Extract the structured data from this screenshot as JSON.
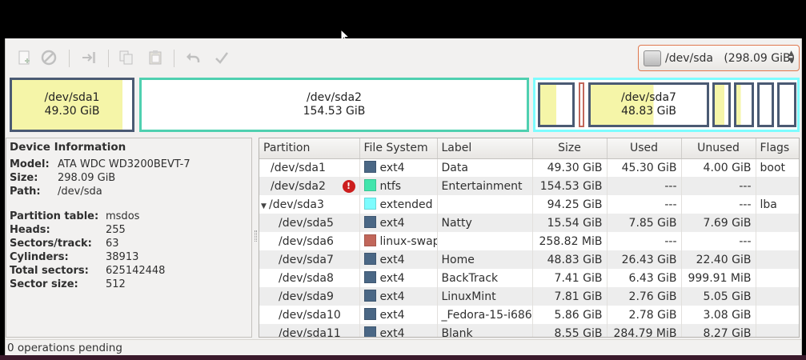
{
  "device_selector": {
    "label": "/dev/sda   (298.09 GiB)",
    "icon": "harddisk-icon"
  },
  "toolbar": {
    "icons": [
      "new-partition-icon",
      "delete-icon",
      "resize-move-icon",
      "copy-icon",
      "paste-icon",
      "undo-icon",
      "apply-icon"
    ]
  },
  "partition_bar": [
    {
      "name": "/dev/sda1",
      "size": "49.30 GiB",
      "border": "#4a5a73",
      "used_fill": 0.92
    },
    {
      "name": "/dev/sda2",
      "size": "154.53 GiB",
      "border": "#4fd0b0",
      "used_fill": 0.0
    },
    {
      "name": "/dev/sda7",
      "size": "48.83 GiB",
      "border": "#4a5a73",
      "used_fill": 0.54
    }
  ],
  "device_info": {
    "title": "Device Information",
    "model_label": "Model:",
    "model": "ATA WDC WD3200BEVT-7",
    "size_label": "Size:",
    "size": "298.09 GiB",
    "path_label": "Path:",
    "path": "/dev/sda",
    "table_label": "Partition table:",
    "table": "msdos",
    "heads_label": "Heads:",
    "heads": "255",
    "sectors_label": "Sectors/track:",
    "sectors": "63",
    "cylinders_label": "Cylinders:",
    "cylinders": "38913",
    "total_label": "Total sectors:",
    "total": "625142448",
    "sectorsize_label": "Sector size:",
    "sectorsize": "512"
  },
  "table": {
    "headers": [
      "Partition",
      "File System",
      "Label",
      "Size",
      "Used",
      "Unused",
      "Flags"
    ],
    "rows": [
      {
        "partition": "/dev/sda1",
        "fs": "ext4",
        "color": "#4a6785",
        "label": "Data",
        "size": "49.30 GiB",
        "used": "45.30 GiB",
        "unused": "4.00 GiB",
        "flags": "boot"
      },
      {
        "partition": "/dev/sda2",
        "fs": "ntfs",
        "color": "#42e5ac",
        "label": "Entertainment",
        "size": "154.53 GiB",
        "used": "---",
        "unused": "---",
        "flags": ""
      },
      {
        "partition": "/dev/sda3",
        "fs": "extended",
        "color": "#7dfcfe",
        "label": "",
        "size": "94.25 GiB",
        "used": "---",
        "unused": "---",
        "flags": "lba"
      },
      {
        "partition": "/dev/sda5",
        "fs": "ext4",
        "color": "#4a6785",
        "label": "Natty",
        "size": "15.54 GiB",
        "used": "7.85 GiB",
        "unused": "7.69 GiB",
        "flags": ""
      },
      {
        "partition": "/dev/sda6",
        "fs": "linux-swap",
        "color": "#c1665a",
        "label": "",
        "size": "258.82 MiB",
        "used": "---",
        "unused": "---",
        "flags": ""
      },
      {
        "partition": "/dev/sda7",
        "fs": "ext4",
        "color": "#4a6785",
        "label": "Home",
        "size": "48.83 GiB",
        "used": "26.43 GiB",
        "unused": "22.40 GiB",
        "flags": ""
      },
      {
        "partition": "/dev/sda8",
        "fs": "ext4",
        "color": "#4a6785",
        "label": "BackTrack",
        "size": "7.41 GiB",
        "used": "6.43 GiB",
        "unused": "999.91 MiB",
        "flags": ""
      },
      {
        "partition": "/dev/sda9",
        "fs": "ext4",
        "color": "#4a6785",
        "label": "LinuxMint",
        "size": "7.81 GiB",
        "used": "2.76 GiB",
        "unused": "5.05 GiB",
        "flags": ""
      },
      {
        "partition": "/dev/sda10",
        "fs": "ext4",
        "color": "#4a6785",
        "label": "_Fedora-15-i686-",
        "size": "5.86 GiB",
        "used": "2.78 GiB",
        "unused": "3.08 GiB",
        "flags": ""
      },
      {
        "partition": "/dev/sda11",
        "fs": "ext4",
        "color": "#4a6785",
        "label": "Blank",
        "size": "8.55 GiB",
        "used": "284.79 MiB",
        "unused": "8.27 GiB",
        "flags": ""
      }
    ]
  },
  "status": "0 operations pending"
}
